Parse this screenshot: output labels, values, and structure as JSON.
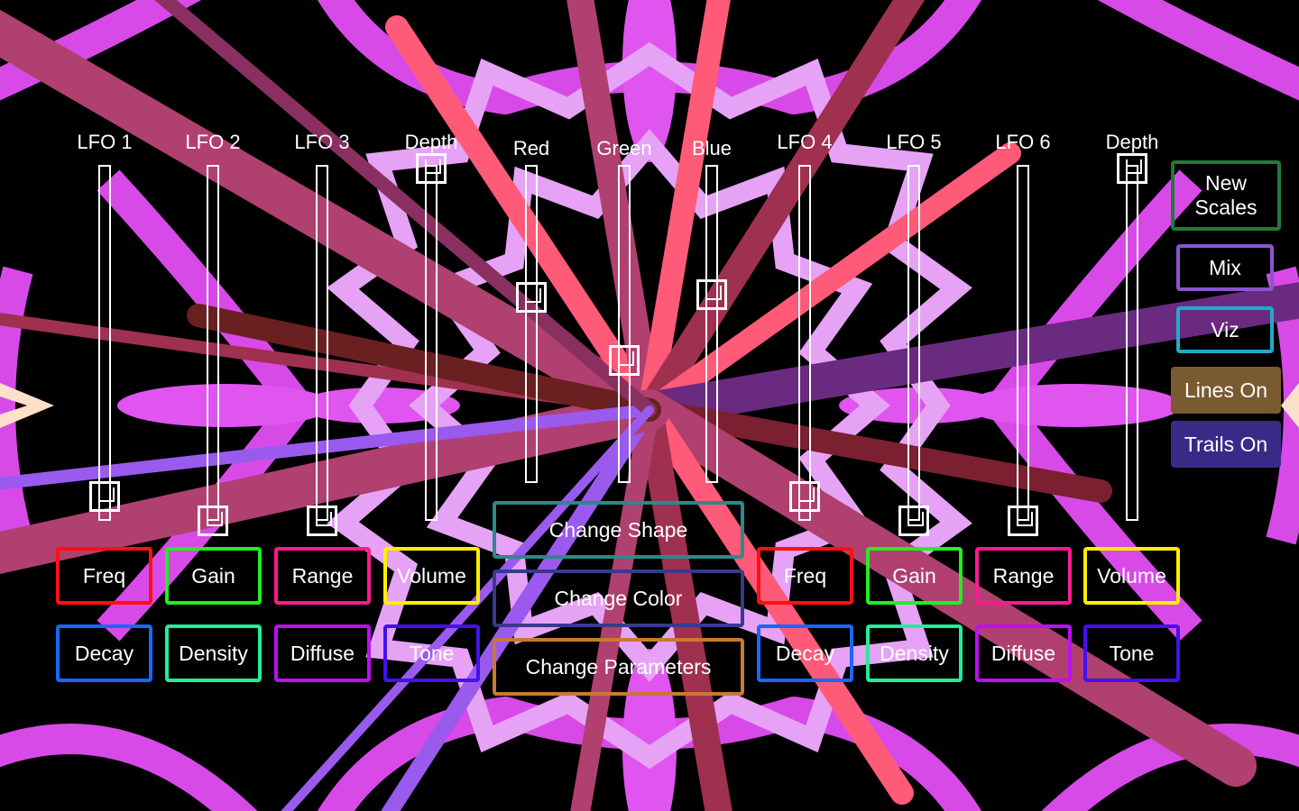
{
  "sliders": [
    {
      "label": "LFO 1",
      "value": 0.07
    },
    {
      "label": "LFO 2",
      "value": 0.0
    },
    {
      "label": "LFO 3",
      "value": 0.0
    },
    {
      "label": "Depth",
      "value": 1.0
    },
    {
      "label": "Red",
      "value": 0.59
    },
    {
      "label": "Green",
      "value": 0.39
    },
    {
      "label": "Blue",
      "value": 0.6
    },
    {
      "label": "LFO 4",
      "value": 0.07
    },
    {
      "label": "LFO 5",
      "value": 0.0
    },
    {
      "label": "LFO 6",
      "value": 0.0
    },
    {
      "label": "Depth",
      "value": 1.0
    }
  ],
  "left_row1": [
    {
      "label": "Freq",
      "color": "#ff1010"
    },
    {
      "label": "Gain",
      "color": "#22ee22"
    },
    {
      "label": "Range",
      "color": "#ff1a8c"
    },
    {
      "label": "Volume",
      "color": "#ffee00"
    }
  ],
  "left_row2": [
    {
      "label": "Decay",
      "color": "#1a66ff"
    },
    {
      "label": "Density",
      "color": "#22ee99"
    },
    {
      "label": "Diffuse",
      "color": "#bb11ee"
    },
    {
      "label": "Tone",
      "color": "#4411ee"
    }
  ],
  "right_row1": [
    {
      "label": "Freq",
      "color": "#ff1010"
    },
    {
      "label": "Gain",
      "color": "#22ee22"
    },
    {
      "label": "Range",
      "color": "#ff1a8c"
    },
    {
      "label": "Volume",
      "color": "#ffee00"
    }
  ],
  "right_row2": [
    {
      "label": "Decay",
      "color": "#1a66ff"
    },
    {
      "label": "Density",
      "color": "#22ee99"
    },
    {
      "label": "Diffuse",
      "color": "#bb11ee"
    },
    {
      "label": "Tone",
      "color": "#4411ee"
    }
  ],
  "center_buttons": [
    {
      "label": "Change Shape",
      "color": "#2a8a8a"
    },
    {
      "label": "Change Color",
      "color": "#3a3a8a"
    },
    {
      "label": "Change Parameters",
      "color": "#c87a30"
    }
  ],
  "side_buttons": [
    {
      "label": "New Scales",
      "color": "#1f7a3a"
    },
    {
      "label": "Mix",
      "color": "#8a55cc"
    },
    {
      "label": "Viz",
      "color": "#22aacc"
    },
    {
      "label": "Lines On",
      "color": "#7a5a30"
    },
    {
      "label": "Trails On",
      "color": "#3a2a88"
    }
  ],
  "colors": {
    "background": "#000000",
    "kaleido_primary": "#e055f0",
    "kaleido_light": "#e8a8f5",
    "rays": [
      "#b04070",
      "#ff5a78",
      "#6a2a80",
      "#9a5aee",
      "#a03050"
    ]
  }
}
